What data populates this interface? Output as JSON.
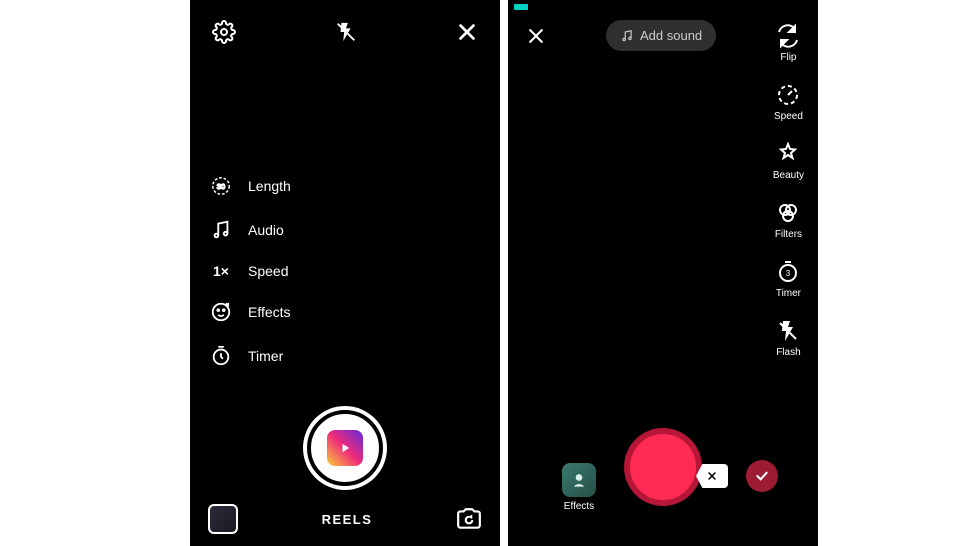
{
  "instagram": {
    "options": {
      "length": "Length",
      "length_value": "30",
      "audio": "Audio",
      "speed": "Speed",
      "speed_value": "1×",
      "effects": "Effects",
      "timer": "Timer"
    },
    "mode_label": "REELS"
  },
  "tiktok": {
    "add_sound": "Add sound",
    "side": {
      "flip": "Flip",
      "speed": "Speed",
      "beauty": "Beauty",
      "filters": "Filters",
      "timer": "Timer",
      "timer_value": "3",
      "flash": "Flash"
    },
    "effects_label": "Effects"
  }
}
